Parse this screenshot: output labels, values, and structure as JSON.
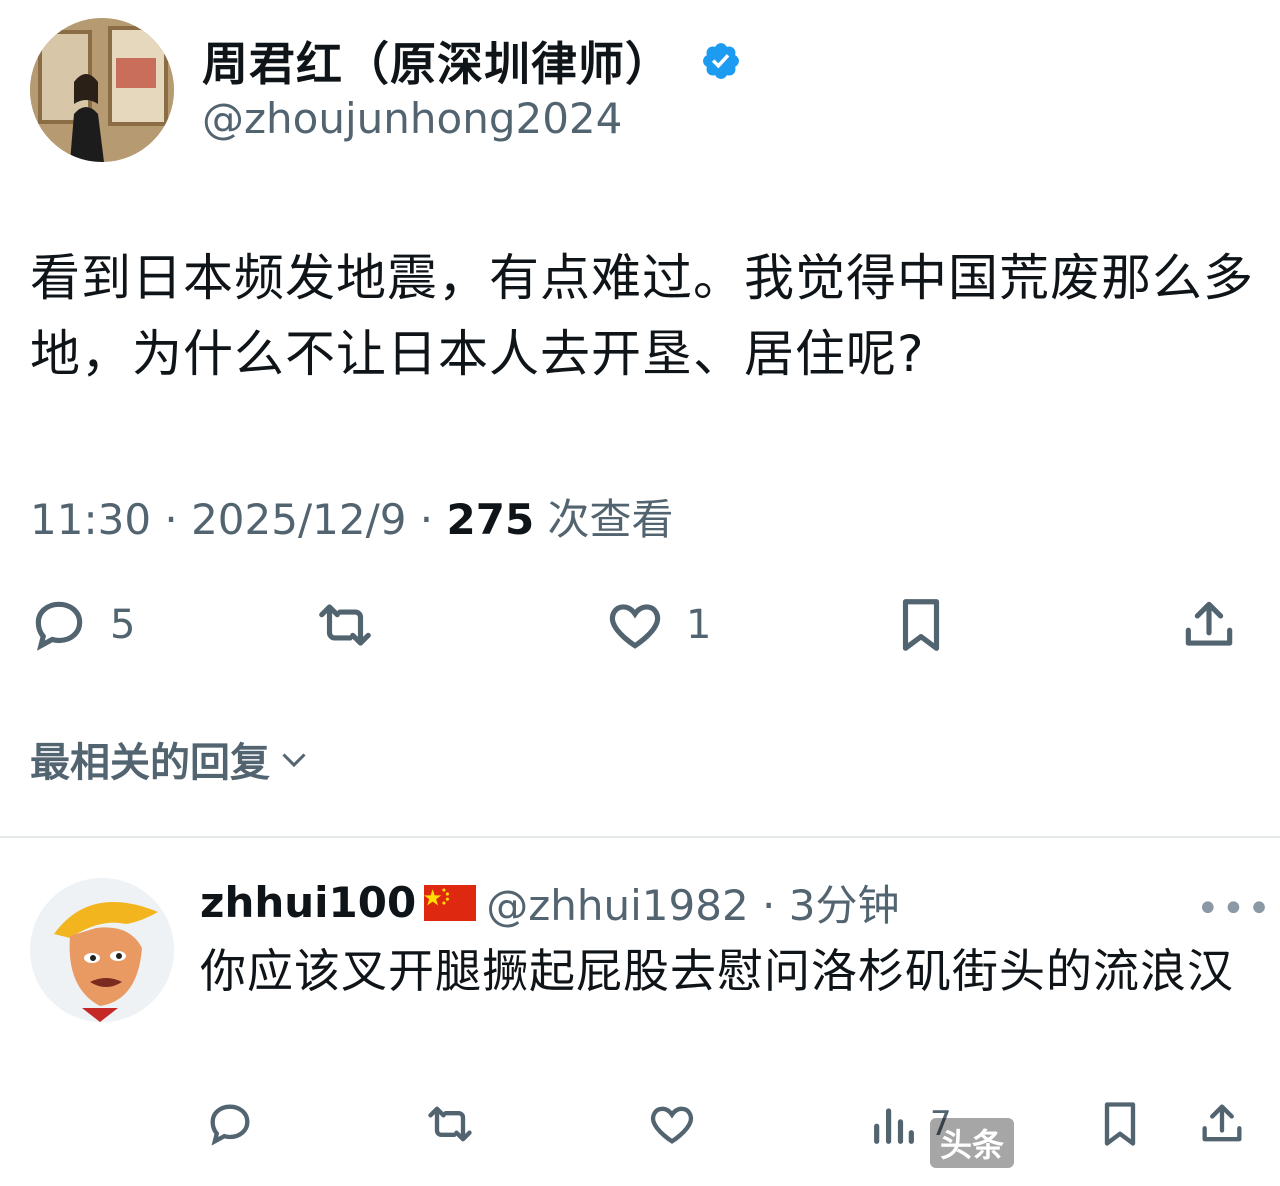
{
  "tweet": {
    "display_name": "周君红（原深圳律师）",
    "handle": "@zhoujunhong2024",
    "text": "看到日本频发地震，有点难过。我觉得中国荒废那么多地，为什么不让日本人去开垦、居住呢?",
    "time": "11:30 · 2025/12/9 · ",
    "views_count": "275",
    "views_label": " 次查看",
    "actions": {
      "reply_count": "5",
      "like_count": "1"
    }
  },
  "replies_filter": "最相关的回复",
  "reply": {
    "display_name": "zhhui100",
    "handle": "@zhhui1982 · 3分钟",
    "more": "•••",
    "text": "你应该叉开腿撅起屁股去慰问洛杉矶街头的流浪汉",
    "views_count": "7"
  },
  "watermark": "头条",
  "colors": {
    "verified": "#1d9bf0",
    "secondary_text": "#536471",
    "primary_text": "#0f1419",
    "divider": "#e6e9ea"
  }
}
